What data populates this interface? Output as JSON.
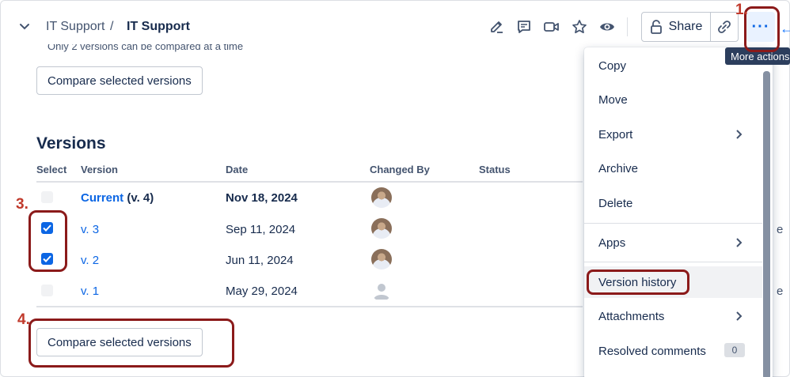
{
  "breadcrumb": {
    "space": "IT Support",
    "separator": "/",
    "page": "IT Support"
  },
  "toolbar": {
    "share_label": "Share",
    "more_glyph": "···",
    "tooltip": "More actions",
    "icons": [
      "edit-icon",
      "comment-icon",
      "video-icon",
      "star-icon",
      "watch-icon",
      "lock-icon",
      "link-icon",
      "more-icon"
    ]
  },
  "hint_text": "Only 2 versions can be compared at a time",
  "compare_button_label": "Compare selected versions",
  "versions": {
    "title": "Versions",
    "columns": [
      "Select",
      "Version",
      "Date",
      "Changed By",
      "Status"
    ],
    "rows": [
      {
        "select": "disabled",
        "version_link": "Current",
        "version_suffix": "(v. 4)",
        "date": "Nov 18, 2024",
        "changed_by": "user-avatar"
      },
      {
        "select": "checked",
        "version_link": "v. 3",
        "version_suffix": "",
        "date": "Sep 11, 2024",
        "changed_by": "user-avatar"
      },
      {
        "select": "checked",
        "version_link": "v. 2",
        "version_suffix": "",
        "date": "Jun 11, 2024",
        "changed_by": "user-avatar"
      },
      {
        "select": "disabled",
        "version_link": "v. 1",
        "version_suffix": "",
        "date": "May 29, 2024",
        "changed_by": "placeholder-avatar"
      }
    ]
  },
  "menu": {
    "items": [
      {
        "label": "Copy",
        "submenu": false
      },
      {
        "label": "Move",
        "submenu": false
      },
      {
        "label": "Export",
        "submenu": true
      },
      {
        "label": "Archive",
        "submenu": false
      },
      {
        "label": "Delete",
        "submenu": false
      },
      {
        "label": "Apps",
        "submenu": true
      },
      {
        "label": "Version history",
        "submenu": false,
        "highlighted": true
      },
      {
        "label": "Attachments",
        "submenu": true
      },
      {
        "label": "Resolved comments",
        "submenu": false,
        "badge": "0"
      }
    ]
  },
  "peek_text": [
    "e",
    "e"
  ],
  "annotations": [
    "1.",
    "3.",
    "4."
  ],
  "colors": {
    "accent": "#0c66e4",
    "annotation": "#8b1a1a",
    "annotation_number": "#c0392b"
  }
}
